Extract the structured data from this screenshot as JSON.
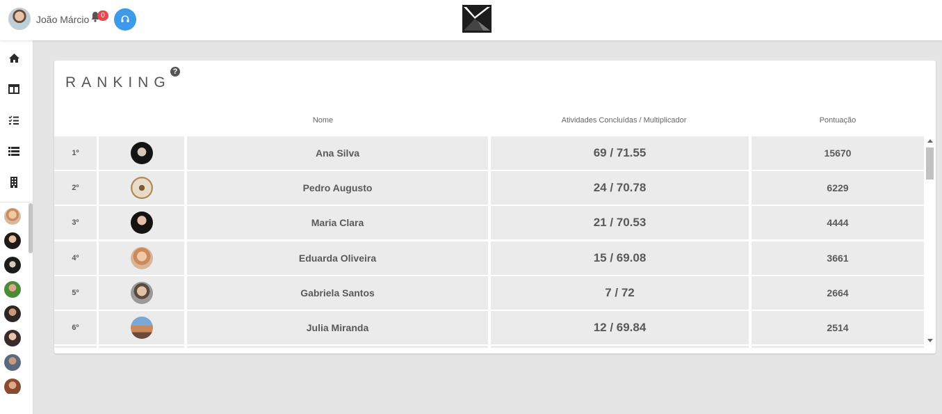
{
  "header": {
    "user_name": "João Márcio",
    "notifications_count": "0",
    "colors": {
      "badge": "#e8474c",
      "support": "#3d9ae8"
    }
  },
  "sidebar": {
    "icons": [
      "home-icon",
      "columns-icon",
      "task-list-icon",
      "list-icon",
      "building-icon"
    ]
  },
  "ranking": {
    "title": "RANKING",
    "help": "?",
    "columns": {
      "name": "Nome",
      "activities": "Atividades Concluídas / Multiplicador",
      "points": "Pontuação"
    },
    "rows": [
      {
        "rank": "1º",
        "name": "Ana Silva",
        "activities": "69 / 71.55",
        "points": "15670"
      },
      {
        "rank": "2º",
        "name": "Pedro Augusto",
        "activities": "24 / 70.78",
        "points": "6229"
      },
      {
        "rank": "3º",
        "name": "Maria Clara",
        "activities": "21 / 70.53",
        "points": "4444"
      },
      {
        "rank": "4º",
        "name": "Eduarda Oliveira",
        "activities": "15 / 69.08",
        "points": "3661"
      },
      {
        "rank": "5º",
        "name": "Gabriela Santos",
        "activities": "7 / 72",
        "points": "2664"
      },
      {
        "rank": "6º",
        "name": "Julia Miranda",
        "activities": "12 / 69.84",
        "points": "2514"
      },
      {
        "rank": "",
        "name": "",
        "activities": "",
        "points": ""
      }
    ]
  }
}
